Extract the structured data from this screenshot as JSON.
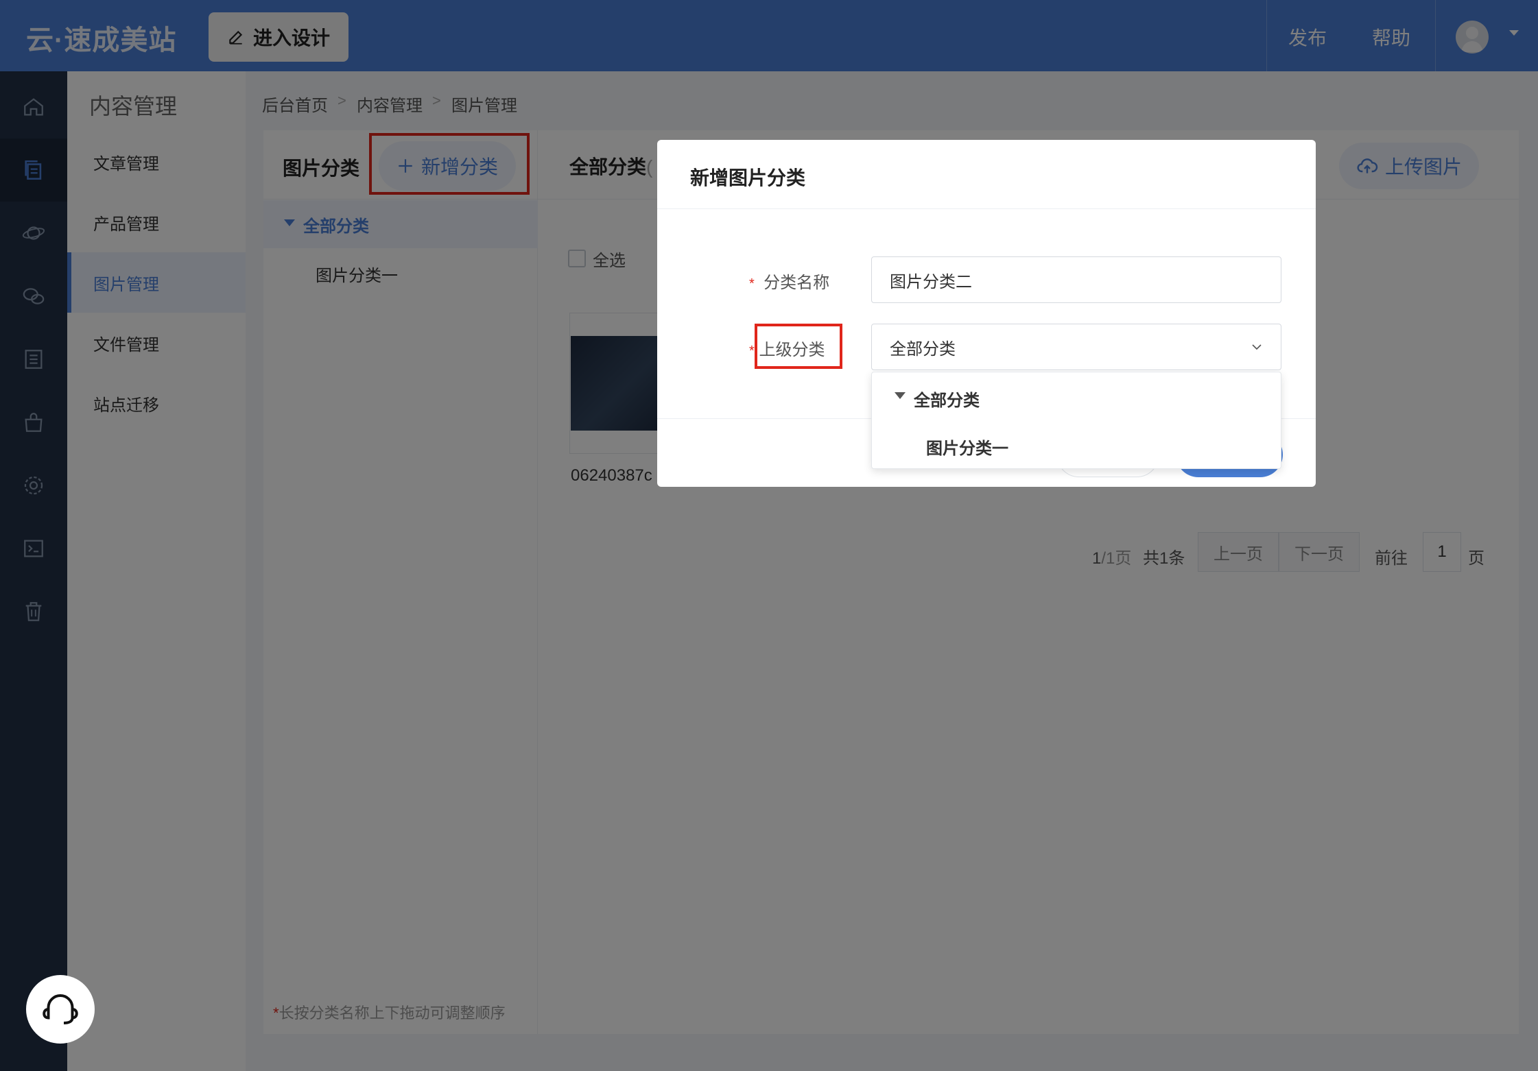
{
  "app": {
    "logo": "云·速成美站",
    "design_button": "进入设计"
  },
  "topnav": {
    "publish": "发布",
    "help": "帮助"
  },
  "sidebar_rail": [
    "home-icon",
    "content-icon",
    "planet-icon",
    "wechat-icon",
    "list-icon",
    "shop-bag-icon",
    "settings-icon",
    "terminal-icon",
    "trash-icon"
  ],
  "submenu": {
    "title": "内容管理",
    "items": [
      {
        "label": "文章管理"
      },
      {
        "label": "产品管理"
      },
      {
        "label": "图片管理"
      },
      {
        "label": "文件管理"
      },
      {
        "label": "站点迁移"
      }
    ]
  },
  "breadcrumb": {
    "home": "后台首页",
    "section": "内容管理",
    "page": "图片管理"
  },
  "category_panel": {
    "title": "图片分类",
    "add_button": "新增分类",
    "all_label": "全部分类",
    "sub_label": "图片分类一",
    "hint_star": "*",
    "hint": "长按分类名称上下拖动可调整顺序"
  },
  "main_panel": {
    "title": "全部分类",
    "title_suffix": "(",
    "upload_button": "上传图片",
    "select_all": "全选",
    "image_name": "06240387c"
  },
  "pager": {
    "page_current": "1",
    "page_total": "/1页",
    "total": "共1条",
    "prev": "上一页",
    "next": "下一页",
    "goto": "前往",
    "page_input": "1",
    "page_unit": "页"
  },
  "modal": {
    "title": "新增图片分类",
    "required_mark": "*",
    "name_label": "分类名称",
    "name_value": "图片分类二",
    "parent_label": "上级分类",
    "parent_value": "全部分类",
    "dropdown": {
      "all": "全部分类",
      "sub": "图片分类一"
    }
  },
  "colors": {
    "accent": "#4a7fd6",
    "topbar": "#4a7fd6",
    "rail": "#223047",
    "highlight_box": "#e0261b"
  }
}
